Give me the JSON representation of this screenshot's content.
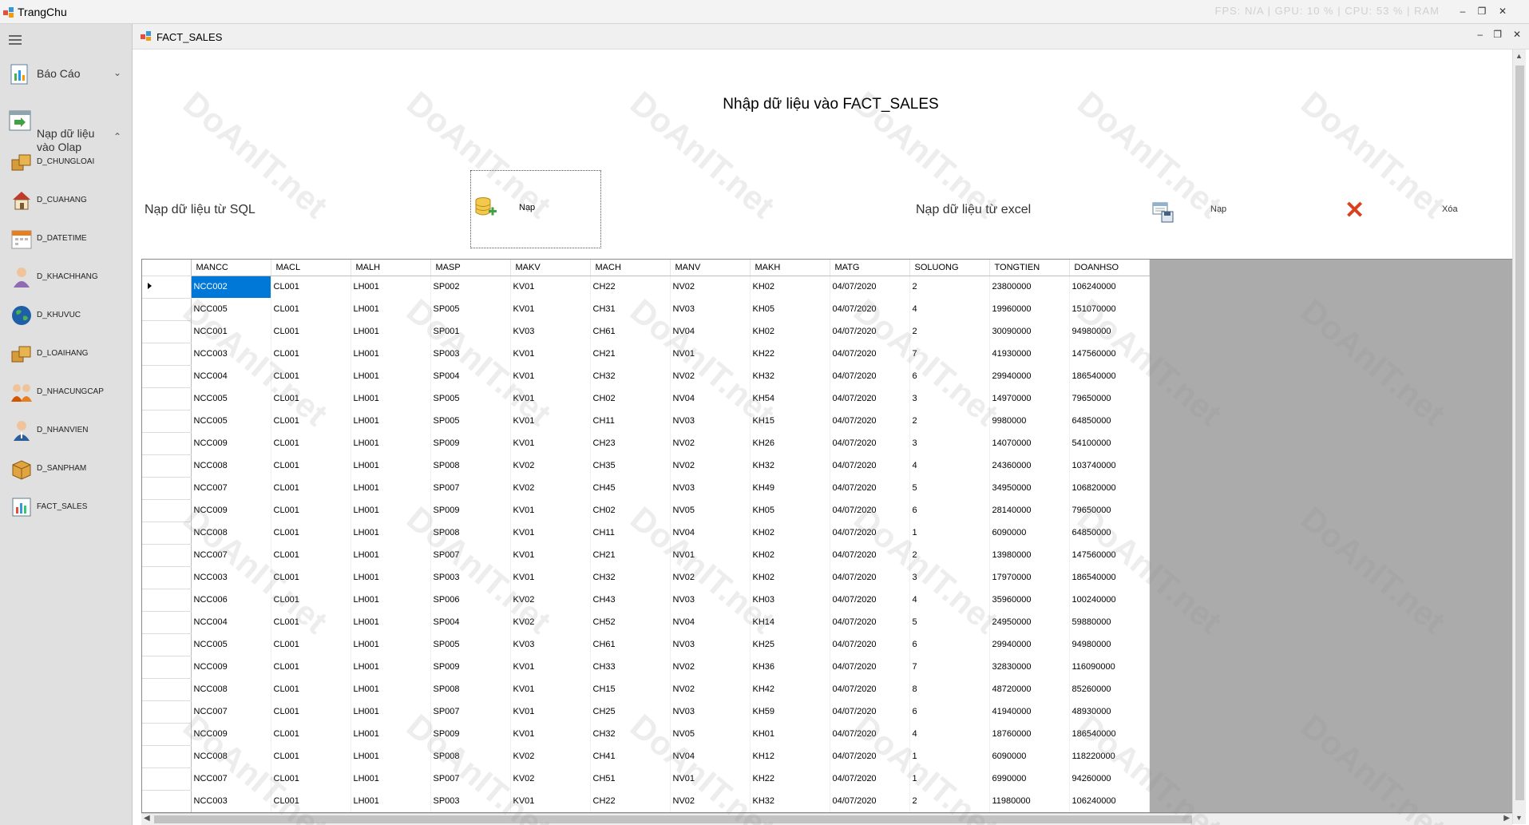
{
  "app": {
    "title": "TrangChu",
    "status_text": "FPS: N/A  |  GPU: 10 %  |  CPU: 53 %  |  RAM"
  },
  "sidebar": {
    "groups": [
      {
        "label": "Báo Cáo",
        "icon": "report-icon"
      },
      {
        "label_line1": "Nạp dữ liệu",
        "label_line2": "vào Olap",
        "icon": "load-olap-icon"
      }
    ],
    "items": [
      {
        "label": "D_CHUNGLOAI",
        "icon": "boxes-icon"
      },
      {
        "label": "D_CUAHANG",
        "icon": "store-icon"
      },
      {
        "label": "D_DATETIME",
        "icon": "calendar-icon"
      },
      {
        "label": "D_KHACHHANG",
        "icon": "customer-icon"
      },
      {
        "label": "D_KHUVUC",
        "icon": "globe-icon"
      },
      {
        "label": "D_LOAIHANG",
        "icon": "boxes-icon"
      },
      {
        "label": "D_NHACUNGCAP",
        "icon": "suppliers-icon"
      },
      {
        "label": "D_NHANVIEN",
        "icon": "employee-icon"
      },
      {
        "label": "D_SANPHAM",
        "icon": "box-icon"
      },
      {
        "label": "FACT_SALES",
        "icon": "sales-chart-icon"
      }
    ]
  },
  "child_window": {
    "title": "FACT_SALES"
  },
  "form": {
    "heading": "Nhập dữ liệu vào FACT_SALES",
    "sql_label": "Nạp dữ liệu từ SQL",
    "sql_button": "Nạp",
    "excel_label": "Nạp dữ liệu từ excel",
    "excel_button": "Nạp",
    "delete_button": "Xóa"
  },
  "grid": {
    "columns": [
      "MANCC",
      "MACL",
      "MALH",
      "MASP",
      "MAKV",
      "MACH",
      "MANV",
      "MAKH",
      "MATG",
      "SOLUONG",
      "TONGTIEN",
      "DOANHSO"
    ],
    "rows": [
      [
        "NCC002",
        "CL001",
        "LH001",
        "SP002",
        "KV01",
        "CH22",
        "NV02",
        "KH02",
        "04/07/2020",
        "2",
        "23800000",
        "106240000"
      ],
      [
        "NCC005",
        "CL001",
        "LH001",
        "SP005",
        "KV01",
        "CH31",
        "NV03",
        "KH05",
        "04/07/2020",
        "4",
        "19960000",
        "151070000"
      ],
      [
        "NCC001",
        "CL001",
        "LH001",
        "SP001",
        "KV03",
        "CH61",
        "NV04",
        "KH02",
        "04/07/2020",
        "2",
        "30090000",
        "94980000"
      ],
      [
        "NCC003",
        "CL001",
        "LH001",
        "SP003",
        "KV01",
        "CH21",
        "NV01",
        "KH22",
        "04/07/2020",
        "7",
        "41930000",
        "147560000"
      ],
      [
        "NCC004",
        "CL001",
        "LH001",
        "SP004",
        "KV01",
        "CH32",
        "NV02",
        "KH32",
        "04/07/2020",
        "6",
        "29940000",
        "186540000"
      ],
      [
        "NCC005",
        "CL001",
        "LH001",
        "SP005",
        "KV01",
        "CH02",
        "NV04",
        "KH54",
        "04/07/2020",
        "3",
        "14970000",
        "79650000"
      ],
      [
        "NCC005",
        "CL001",
        "LH001",
        "SP005",
        "KV01",
        "CH11",
        "NV03",
        "KH15",
        "04/07/2020",
        "2",
        "9980000",
        "64850000"
      ],
      [
        "NCC009",
        "CL001",
        "LH001",
        "SP009",
        "KV01",
        "CH23",
        "NV02",
        "KH26",
        "04/07/2020",
        "3",
        "14070000",
        "54100000"
      ],
      [
        "NCC008",
        "CL001",
        "LH001",
        "SP008",
        "KV02",
        "CH35",
        "NV02",
        "KH32",
        "04/07/2020",
        "4",
        "24360000",
        "103740000"
      ],
      [
        "NCC007",
        "CL001",
        "LH001",
        "SP007",
        "KV02",
        "CH45",
        "NV03",
        "KH49",
        "04/07/2020",
        "5",
        "34950000",
        "106820000"
      ],
      [
        "NCC009",
        "CL001",
        "LH001",
        "SP009",
        "KV01",
        "CH02",
        "NV05",
        "KH05",
        "04/07/2020",
        "6",
        "28140000",
        "79650000"
      ],
      [
        "NCC008",
        "CL001",
        "LH001",
        "SP008",
        "KV01",
        "CH11",
        "NV04",
        "KH02",
        "04/07/2020",
        "1",
        "6090000",
        "64850000"
      ],
      [
        "NCC007",
        "CL001",
        "LH001",
        "SP007",
        "KV01",
        "CH21",
        "NV01",
        "KH02",
        "04/07/2020",
        "2",
        "13980000",
        "147560000"
      ],
      [
        "NCC003",
        "CL001",
        "LH001",
        "SP003",
        "KV01",
        "CH32",
        "NV02",
        "KH02",
        "04/07/2020",
        "3",
        "17970000",
        "186540000"
      ],
      [
        "NCC006",
        "CL001",
        "LH001",
        "SP006",
        "KV02",
        "CH43",
        "NV03",
        "KH03",
        "04/07/2020",
        "4",
        "35960000",
        "100240000"
      ],
      [
        "NCC004",
        "CL001",
        "LH001",
        "SP004",
        "KV02",
        "CH52",
        "NV04",
        "KH14",
        "04/07/2020",
        "5",
        "24950000",
        "59880000"
      ],
      [
        "NCC005",
        "CL001",
        "LH001",
        "SP005",
        "KV03",
        "CH61",
        "NV03",
        "KH25",
        "04/07/2020",
        "6",
        "29940000",
        "94980000"
      ],
      [
        "NCC009",
        "CL001",
        "LH001",
        "SP009",
        "KV01",
        "CH33",
        "NV02",
        "KH36",
        "04/07/2020",
        "7",
        "32830000",
        "116090000"
      ],
      [
        "NCC008",
        "CL001",
        "LH001",
        "SP008",
        "KV01",
        "CH15",
        "NV02",
        "KH42",
        "04/07/2020",
        "8",
        "48720000",
        "85260000"
      ],
      [
        "NCC007",
        "CL001",
        "LH001",
        "SP007",
        "KV01",
        "CH25",
        "NV03",
        "KH59",
        "04/07/2020",
        "6",
        "41940000",
        "48930000"
      ],
      [
        "NCC009",
        "CL001",
        "LH001",
        "SP009",
        "KV01",
        "CH32",
        "NV05",
        "KH01",
        "04/07/2020",
        "4",
        "18760000",
        "186540000"
      ],
      [
        "NCC008",
        "CL001",
        "LH001",
        "SP008",
        "KV02",
        "CH41",
        "NV04",
        "KH12",
        "04/07/2020",
        "1",
        "6090000",
        "118220000"
      ],
      [
        "NCC007",
        "CL001",
        "LH001",
        "SP007",
        "KV02",
        "CH51",
        "NV01",
        "KH22",
        "04/07/2020",
        "1",
        "6990000",
        "94260000"
      ],
      [
        "NCC003",
        "CL001",
        "LH001",
        "SP003",
        "KV01",
        "CH22",
        "NV02",
        "KH32",
        "04/07/2020",
        "2",
        "11980000",
        "106240000"
      ]
    ]
  },
  "watermark": {
    "text": "DoAnIT.net"
  }
}
